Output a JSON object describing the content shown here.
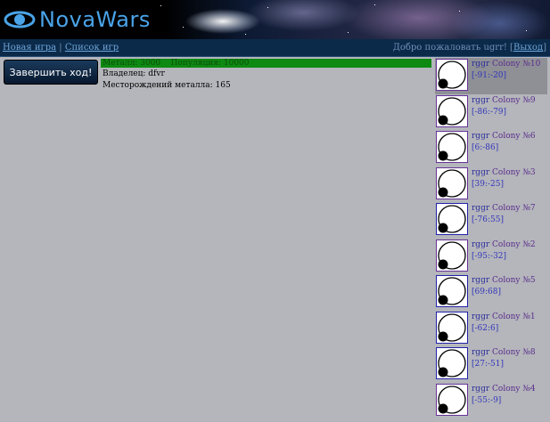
{
  "header": {
    "logo_text": "NovaWars"
  },
  "nav": {
    "new_game": "Новая игра",
    "separator": "|",
    "game_list": "Список игр",
    "welcome": "Добро пожаловать ugrr! [",
    "exit": "Выход",
    "welcome_end": "]"
  },
  "end_turn_label": "Завершить ход!",
  "planet": {
    "resources": "Металл: 3000    Популяция: 10000",
    "owner_line": "Владелец: dfvr",
    "deposits_line": "Месторождений металла: 165"
  },
  "colonies": [
    {
      "owner": "rggr",
      "name": "Colony №10",
      "coords": "[-91:-20]",
      "selected": true,
      "border": "#663399"
    },
    {
      "owner": "rggr",
      "name": "Colony №9",
      "coords": "[-86:-79]",
      "selected": false,
      "border": "#663399"
    },
    {
      "owner": "rggr",
      "name": "Colony №6",
      "coords": "[6:-86]",
      "selected": false,
      "border": "#663399"
    },
    {
      "owner": "rggr",
      "name": "Colony №3",
      "coords": "[39:-25]",
      "selected": false,
      "border": "#663399"
    },
    {
      "owner": "rggr",
      "name": "Colony №7",
      "coords": "[-76:55]",
      "selected": false,
      "border": "#2222aa"
    },
    {
      "owner": "rggr",
      "name": "Colony №2",
      "coords": "[-95:-32]",
      "selected": false,
      "border": "#663399"
    },
    {
      "owner": "rggr",
      "name": "Colony №5",
      "coords": "[69:68]",
      "selected": false,
      "border": "#2222aa"
    },
    {
      "owner": "rggr",
      "name": "Colony №1",
      "coords": "[-62:6]",
      "selected": false,
      "border": "#2222aa"
    },
    {
      "owner": "rggr",
      "name": "Colony №8",
      "coords": "[27:-51]",
      "selected": false,
      "border": "#2222aa"
    },
    {
      "owner": "rggr",
      "name": "Colony №4",
      "coords": "[-55:-9]",
      "selected": false,
      "border": "#663399"
    }
  ],
  "colors": {
    "resource_bar": "#0e8a12",
    "banner_text": "#4aa3e8",
    "nav_bg": "#0b2a4a"
  },
  "icons": {
    "logo": "planet-ring-icon",
    "colony": "planet-orbit-icon"
  }
}
